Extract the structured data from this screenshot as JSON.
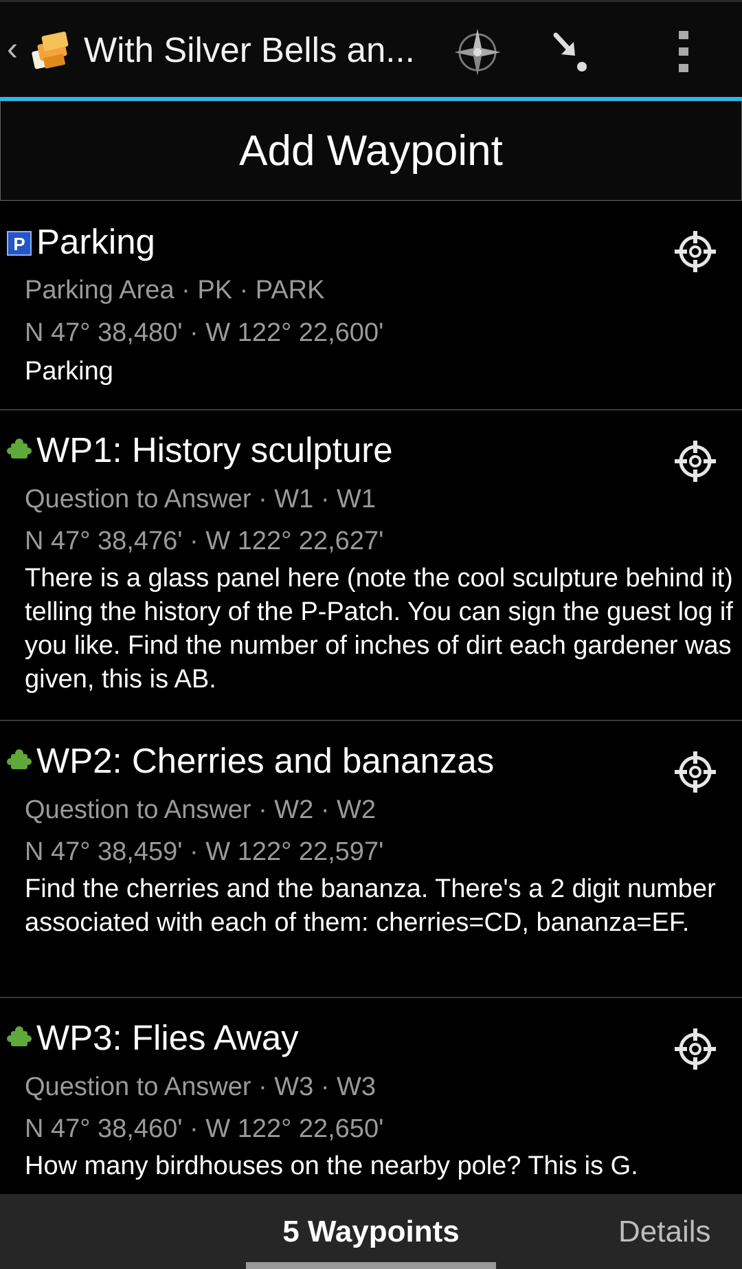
{
  "action_bar": {
    "title": "With Silver Bells an...",
    "icons": {
      "back": "chevron-left-icon",
      "app": "cache-stack-icon",
      "navigate": "compass-icon",
      "import": "arrow-down-right-icon",
      "overflow": "overflow-menu-icon"
    }
  },
  "add_waypoint_label": "Add Waypoint",
  "waypoints": [
    {
      "name": "Parking",
      "type_icon": "parking-icon",
      "subtitle": "Parking Area · PK · PARK",
      "coords": "N 47° 38,480' · W 122° 22,600'",
      "note": "Parking"
    },
    {
      "name": "WP1: History sculpture",
      "type_icon": "puzzle-icon",
      "subtitle": "Question to Answer · W1 · W1",
      "coords": "N 47° 38,476' · W 122° 22,627'",
      "note": "There is a glass panel here (note the cool sculpture behind it) telling the history of the P-Patch. You can sign the guest log if you like. Find the number of inches of dirt each gardener was given, this is AB."
    },
    {
      "name": "WP2: Cherries and bananzas",
      "type_icon": "puzzle-icon",
      "subtitle": "Question to Answer · W2 · W2",
      "coords": "N 47° 38,459' · W 122° 22,597'",
      "note": "Find the cherries and the bananza. There's a 2 digit number associated with each of them: cherries=CD, bananza=EF."
    },
    {
      "name": "WP3: Flies Away",
      "type_icon": "puzzle-icon",
      "subtitle": "Question to Answer · W3 · W3",
      "coords": "N 47° 38,460' · W 122° 22,650'",
      "note": "How many birdhouses on the nearby pole? This is G."
    }
  ],
  "tabs": {
    "waypoints": "5 Waypoints",
    "details": "Details"
  },
  "colors": {
    "accent": "#33b5e5",
    "background": "#000000",
    "secondary_text": "#9a9a9a"
  }
}
